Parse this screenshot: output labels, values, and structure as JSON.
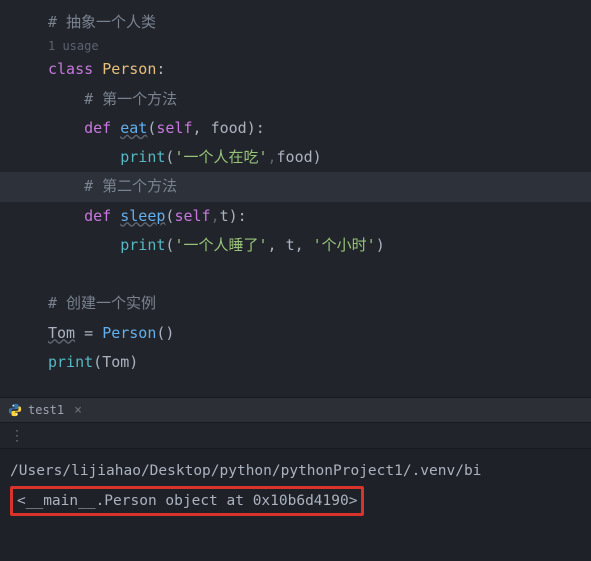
{
  "editor": {
    "usage_hint": "1 usage",
    "lines": {
      "c_abstract": "# 抽象一个人类",
      "kw_class": "class",
      "cls_name": "Person",
      "colon": ":",
      "c_method1": "# 第一个方法",
      "kw_def": "def",
      "fn_eat": "eat",
      "p_self": "self",
      "p_food": "food",
      "builtin_print": "print",
      "str_eat": "'一个人在吃'",
      "hint_comma": ",",
      "arg_food": "food",
      "c_method2": "# 第二个方法",
      "fn_sleep": "sleep",
      "p_t": "t",
      "str_sleep1": "'一个人睡了'",
      "arg_t": "t",
      "str_hours": "'个小时'",
      "c_instance": "# 创建一个实例",
      "var_tom": "Tom",
      "eq": " = ",
      "call_person": "Person",
      "print_tom_arg": "Tom"
    }
  },
  "tab": {
    "name": "test1"
  },
  "toolbar": {
    "dots": "⋮"
  },
  "console": {
    "path": "/Users/lijiahao/Desktop/python/pythonProject1/.venv/bi",
    "output": "<__main__.Person object at 0x10b6d4190>"
  }
}
